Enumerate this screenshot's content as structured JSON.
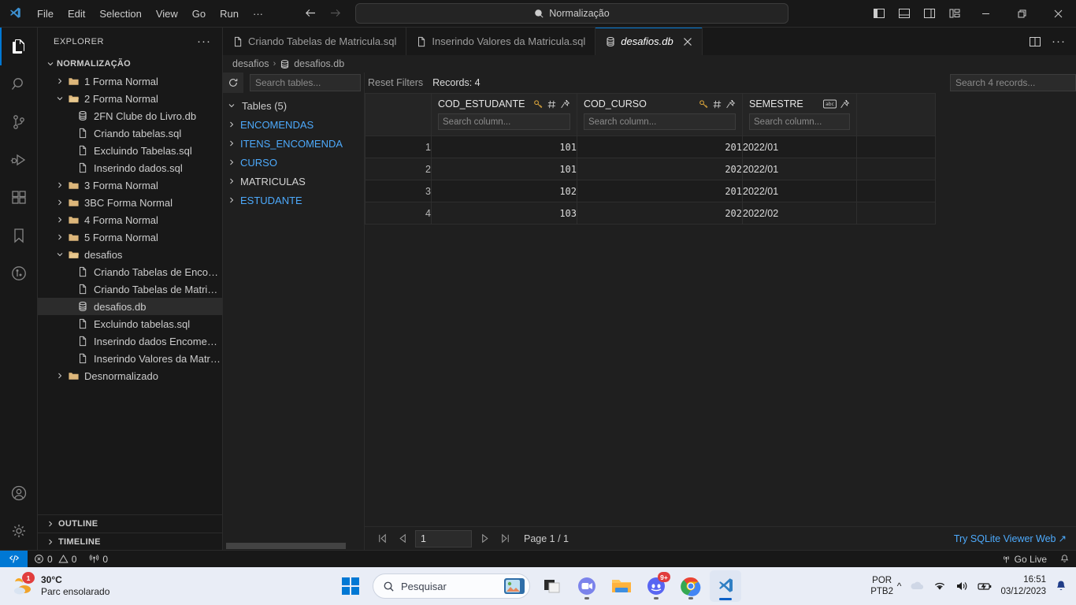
{
  "titlebar": {
    "menus": [
      "File",
      "Edit",
      "Selection",
      "View",
      "Go",
      "Run",
      "···"
    ],
    "command_center_text": "Normalização",
    "search_icon": "search-icon",
    "back_icon": "arrow-left-icon",
    "forward_icon": "arrow-right-icon",
    "layout_icons": [
      "toggle-primary-sidebar-icon",
      "toggle-panel-icon",
      "toggle-secondary-sidebar-icon",
      "customize-layout-icon"
    ],
    "window_controls": [
      "minimize",
      "restore",
      "close"
    ]
  },
  "activitybar": {
    "items": [
      {
        "name": "explorer",
        "icon": "files-icon",
        "active": true
      },
      {
        "name": "search",
        "icon": "search-icon",
        "active": false
      },
      {
        "name": "source-control",
        "icon": "source-control-icon",
        "active": false
      },
      {
        "name": "run-and-debug",
        "icon": "run-debug-icon",
        "active": false
      },
      {
        "name": "extensions",
        "icon": "extensions-icon",
        "active": false
      },
      {
        "name": "bookmarks",
        "icon": "bookmark-icon",
        "active": false
      },
      {
        "name": "git-graph",
        "icon": "git-graph-icon",
        "active": false
      }
    ],
    "bottom": [
      {
        "name": "accounts",
        "icon": "account-icon"
      },
      {
        "name": "settings",
        "icon": "gear-icon"
      }
    ]
  },
  "explorer": {
    "header": "EXPLORER",
    "more_actions": "···",
    "root": "NORMALIZAÇÃO",
    "tree": [
      {
        "label": "1 Forma Normal",
        "type": "folder",
        "expanded": false,
        "depth": 1
      },
      {
        "label": "2 Forma Normal",
        "type": "folder",
        "expanded": true,
        "depth": 1
      },
      {
        "label": "2FN Clube do Livro.db",
        "type": "db",
        "depth": 2
      },
      {
        "label": "Criando tabelas.sql",
        "type": "file",
        "depth": 2
      },
      {
        "label": "Excluindo Tabelas.sql",
        "type": "file",
        "depth": 2
      },
      {
        "label": "Inserindo dados.sql",
        "type": "file",
        "depth": 2
      },
      {
        "label": "3 Forma Normal",
        "type": "folder",
        "expanded": false,
        "depth": 1
      },
      {
        "label": "3BC Forma Normal",
        "type": "folder",
        "expanded": false,
        "depth": 1
      },
      {
        "label": "4 Forma Normal",
        "type": "folder",
        "expanded": false,
        "depth": 1
      },
      {
        "label": "5 Forma Normal",
        "type": "folder",
        "expanded": false,
        "depth": 1
      },
      {
        "label": "desafios",
        "type": "folder",
        "expanded": true,
        "depth": 1
      },
      {
        "label": "Criando Tabelas de Encome...",
        "type": "file",
        "depth": 2
      },
      {
        "label": "Criando Tabelas de Matricul...",
        "type": "file",
        "depth": 2
      },
      {
        "label": "desafios.db",
        "type": "db",
        "depth": 2,
        "selected": true
      },
      {
        "label": "Excluindo tabelas.sql",
        "type": "file",
        "depth": 2
      },
      {
        "label": "Inserindo dados Encomend...",
        "type": "file",
        "depth": 2
      },
      {
        "label": "Inserindo Valores da Matric...",
        "type": "file",
        "depth": 2
      },
      {
        "label": "Desnormalizado",
        "type": "folder",
        "expanded": false,
        "depth": 1
      }
    ],
    "bottom_panels": [
      "OUTLINE",
      "TIMELINE"
    ]
  },
  "tabs": [
    {
      "label": "Criando Tabelas de Matricula.sql",
      "icon": "file-icon",
      "active": false,
      "closable": false
    },
    {
      "label": "Inserindo Valores da Matricula.sql",
      "icon": "file-icon",
      "active": false,
      "closable": false
    },
    {
      "label": "desafios.db",
      "icon": "database-icon",
      "active": true,
      "closable": true
    }
  ],
  "tab_actions": [
    "split-editor-icon",
    "more-actions-icon"
  ],
  "breadcrumb": {
    "folder": "desafios",
    "separator": "›",
    "file": "desafios.db",
    "file_icon": "database-icon"
  },
  "tables_pane": {
    "refresh_icon": "refresh-icon",
    "search_placeholder": "Search tables...",
    "root_label": "Tables (5)",
    "tables": [
      {
        "name": "ENCOMENDAS",
        "selected": false
      },
      {
        "name": "ITENS_ENCOMENDA",
        "selected": false
      },
      {
        "name": "CURSO",
        "selected": false
      },
      {
        "name": "MATRICULAS",
        "selected": true
      },
      {
        "name": "ESTUDANTE",
        "selected": false
      }
    ]
  },
  "grid_toolbar": {
    "reset_filters": "Reset Filters",
    "records_label": "Records: 4",
    "search_placeholder": "Search 4 records..."
  },
  "chart_data": {
    "type": "table",
    "title": "MATRICULAS",
    "columns": [
      {
        "name": "COD_ESTUDANTE",
        "icons": [
          "primary-key-icon",
          "integer-type-icon",
          "pin-icon"
        ],
        "search_placeholder": "Search column...",
        "align": "right"
      },
      {
        "name": "COD_CURSO",
        "icons": [
          "primary-key-icon",
          "integer-type-icon",
          "pin-icon"
        ],
        "search_placeholder": "Search column...",
        "align": "right"
      },
      {
        "name": "SEMESTRE",
        "icons": [
          "text-type-icon",
          "pin-icon"
        ],
        "search_placeholder": "Search column...",
        "align": "left"
      }
    ],
    "rows": [
      {
        "n": "1",
        "values": [
          "101",
          "201",
          "2022/01"
        ]
      },
      {
        "n": "2",
        "values": [
          "101",
          "202",
          "2022/01"
        ]
      },
      {
        "n": "3",
        "values": [
          "102",
          "201",
          "2022/01"
        ]
      },
      {
        "n": "4",
        "values": [
          "103",
          "202",
          "2022/02"
        ]
      }
    ],
    "record_count": 4
  },
  "pager": {
    "first_icon": "page-first-icon",
    "prev_icon": "page-prev-icon",
    "page_value": "1",
    "next_icon": "page-next-icon",
    "last_icon": "page-last-icon",
    "page_label": "Page 1 / 1",
    "try_web_label": "Try SQLite Viewer Web",
    "try_web_arrow": "↗"
  },
  "statusbar": {
    "remote_icon": "remote-window-icon",
    "errors": "0",
    "warnings": "0",
    "ports": "0",
    "golive": "Go Live",
    "bell_icon": "bell-icon"
  },
  "taskbar": {
    "weather_temp": "30°C",
    "weather_desc": "Parc ensolarado",
    "weather_badge": "1",
    "search_placeholder": "Pesquisar",
    "apps": [
      {
        "name": "start",
        "icon": "windows-icon"
      },
      {
        "name": "task-view",
        "icon": "task-view-icon"
      },
      {
        "name": "teams",
        "icon": "teams-icon"
      },
      {
        "name": "file-explorer",
        "icon": "folder-icon"
      },
      {
        "name": "discord",
        "icon": "discord-icon",
        "badge": "9+"
      },
      {
        "name": "chrome",
        "icon": "chrome-icon"
      },
      {
        "name": "vscode",
        "icon": "vscode-icon",
        "active": true
      }
    ],
    "tray_chevron": "^",
    "language": [
      "POR",
      "PTB2"
    ],
    "time": "16:51",
    "date": "03/12/2023",
    "tray_icons": [
      "onedrive-icon",
      "wifi-icon",
      "volume-icon",
      "battery-icon",
      "notification-bell-icon"
    ]
  },
  "colors": {
    "accent": "#0078d4",
    "link": "#4daafc",
    "key_gold": "#d9a43b",
    "editor_bg": "#1f1f1f",
    "chrome_bg": "#181818"
  }
}
